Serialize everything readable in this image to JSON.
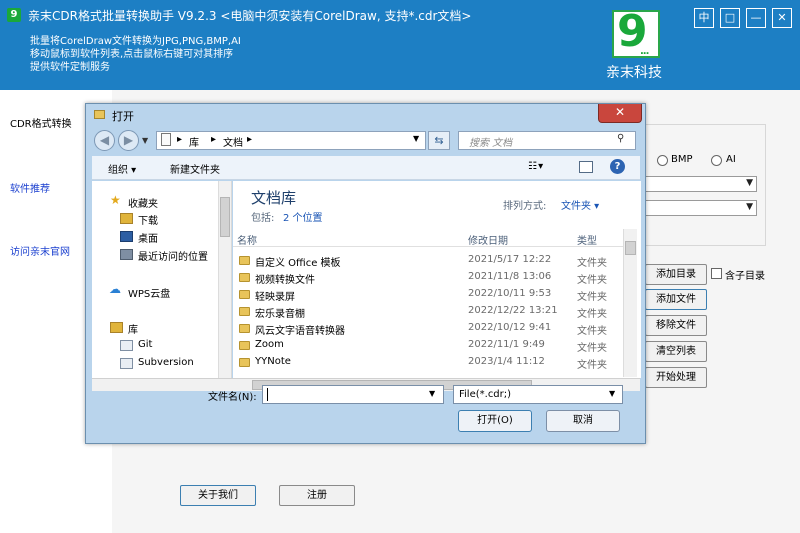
{
  "app": {
    "logo_char": "9",
    "title": "亲末CDR格式批量转换助手   V9.2.3   <电脑中须安装有CorelDraw, 支持*.cdr文档>",
    "info_lines": [
      "批量将CorelDraw文件转换为JPG,PNG,BMP,AI",
      "移动鼠标到软件列表,点击鼠标右键可对其排序",
      "提供软件定制服务"
    ],
    "brand_logo_digit": "9",
    "brand_logo_dots": "...",
    "brand_name": "亲末科技",
    "window_buttons": {
      "pin": "中",
      "restore": "□",
      "minimize": "—",
      "close": "✕"
    }
  },
  "nav": {
    "items": [
      "CDR格式转换",
      "软件推荐",
      "访问亲末官网"
    ]
  },
  "options": {
    "formats": [
      "BMP",
      "AI"
    ]
  },
  "actions": {
    "add_folder": "添加目录",
    "include_subfolders": "含子目录",
    "add_file": "添加文件",
    "remove_file": "移除文件",
    "clear_list": "清空列表",
    "start": "开始处理",
    "about": "关于我们",
    "register": "注册"
  },
  "dialog": {
    "title": "打开",
    "address": [
      "库",
      "文档"
    ],
    "search_placeholder": "搜索 文档",
    "toolbar": {
      "organize": "组织 ▾",
      "new_folder": "新建文件夹"
    },
    "tree": {
      "favorites": "收藏夹",
      "downloads": "下载",
      "desktop": "桌面",
      "recent": "最近访问的位置",
      "wps": "WPS云盘",
      "libraries": "库",
      "git": "Git",
      "subversion": "Subversion"
    },
    "library_title": "文档库",
    "library_includes": "包括:",
    "library_locations": "2 个位置",
    "sort_label": "排列方式:",
    "sort_value": "文件夹 ▾",
    "columns": {
      "name": "名称",
      "date": "修改日期",
      "type": "类型"
    },
    "rows": [
      {
        "name": "自定义 Office 模板",
        "date": "2021/5/17 12:22",
        "type": "文件夹"
      },
      {
        "name": "视频转换文件",
        "date": "2021/11/8 13:06",
        "type": "文件夹"
      },
      {
        "name": "轻映录屏",
        "date": "2022/10/11 9:53",
        "type": "文件夹"
      },
      {
        "name": "宏乐录音棚",
        "date": "2022/12/22 13:21",
        "type": "文件夹"
      },
      {
        "name": "风云文字语音转换器",
        "date": "2022/10/12 9:41",
        "type": "文件夹"
      },
      {
        "name": "Zoom",
        "date": "2022/11/1 9:49",
        "type": "文件夹"
      },
      {
        "name": "YYNote",
        "date": "2023/1/4 11:12",
        "type": "文件夹"
      }
    ],
    "filename_label": "文件名(N):",
    "filename_value": "",
    "filetype": "File(*.cdr;)",
    "open_button": "打开(O)",
    "cancel_button": "取消"
  }
}
